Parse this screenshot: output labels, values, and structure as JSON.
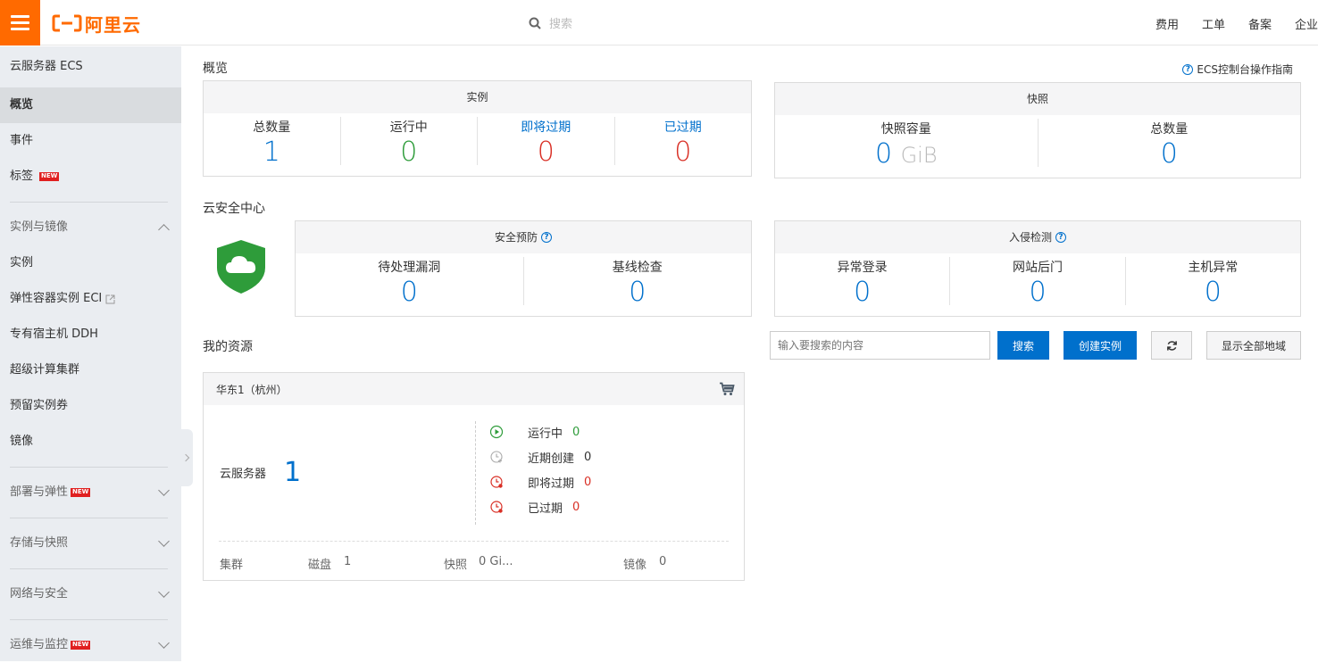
{
  "header": {
    "logo_text": "阿里云",
    "search_placeholder": "搜索",
    "links": [
      "费用",
      "工单",
      "备案",
      "企业"
    ]
  },
  "sidebar": {
    "title": "云服务器 ECS",
    "top_items": [
      {
        "label": "概览",
        "active": true
      },
      {
        "label": "事件"
      },
      {
        "label": "标签",
        "badge": "NEW"
      }
    ],
    "group_instances": {
      "label": "实例与镜像",
      "expanded": true
    },
    "instance_items": [
      {
        "label": "实例"
      },
      {
        "label": "弹性容器实例 ECI"
      },
      {
        "label": "专有宿主机 DDH"
      },
      {
        "label": "超级计算集群"
      },
      {
        "label": "预留实例券"
      },
      {
        "label": "镜像"
      }
    ],
    "groups": [
      {
        "label": "部署与弹性",
        "badge": "NEW"
      },
      {
        "label": "存储与快照"
      },
      {
        "label": "网络与安全"
      },
      {
        "label": "运维与监控",
        "badge": "NEW"
      }
    ]
  },
  "overview": {
    "title": "概览",
    "guide_link": "ECS控制台操作指南",
    "instances": {
      "header": "实例",
      "stats": [
        {
          "label": "总数量",
          "value": "1"
        },
        {
          "label": "运行中",
          "value": "0"
        },
        {
          "label": "即将过期",
          "value": "0"
        },
        {
          "label": "已过期",
          "value": "0"
        }
      ]
    },
    "snapshots": {
      "header": "快照",
      "capacity_label": "快照容量",
      "capacity_value": "0",
      "capacity_unit": "GiB",
      "total_label": "总数量",
      "total_value": "0"
    }
  },
  "security": {
    "title": "云安全中心",
    "prevention": {
      "header": "安全预防",
      "stats": [
        {
          "label": "待处理漏洞",
          "value": "0"
        },
        {
          "label": "基线检查",
          "value": "0"
        }
      ]
    },
    "intrusion": {
      "header": "入侵检测",
      "stats": [
        {
          "label": "异常登录",
          "value": "0"
        },
        {
          "label": "网站后门",
          "value": "0"
        },
        {
          "label": "主机异常",
          "value": "0"
        }
      ]
    }
  },
  "resources": {
    "title": "我的资源",
    "search_placeholder": "输入要搜索的内容",
    "search_button": "搜索",
    "create_button": "创建实例",
    "show_all_button": "显示全部地域",
    "region": {
      "name": "华东1（杭州）",
      "server_label": "云服务器",
      "server_count": "1",
      "statuses": [
        {
          "label": "运行中",
          "value": "0",
          "color": "#2e9c3a"
        },
        {
          "label": "近期创建",
          "value": "0",
          "color": "#333333"
        },
        {
          "label": "即将过期",
          "value": "0",
          "color": "#d93026"
        },
        {
          "label": "已过期",
          "value": "0",
          "color": "#d93026"
        }
      ],
      "footer": {
        "cluster_label": "集群",
        "disk_label": "磁盘",
        "disk_value": "1",
        "snapshot_label": "快照",
        "snapshot_value": "0 Gi...",
        "image_label": "镜像",
        "image_value": "0"
      }
    }
  },
  "colors": {
    "brand": "#ff6a00",
    "primary": "#0070cc",
    "success": "#2e9c3a",
    "danger": "#d93026"
  }
}
